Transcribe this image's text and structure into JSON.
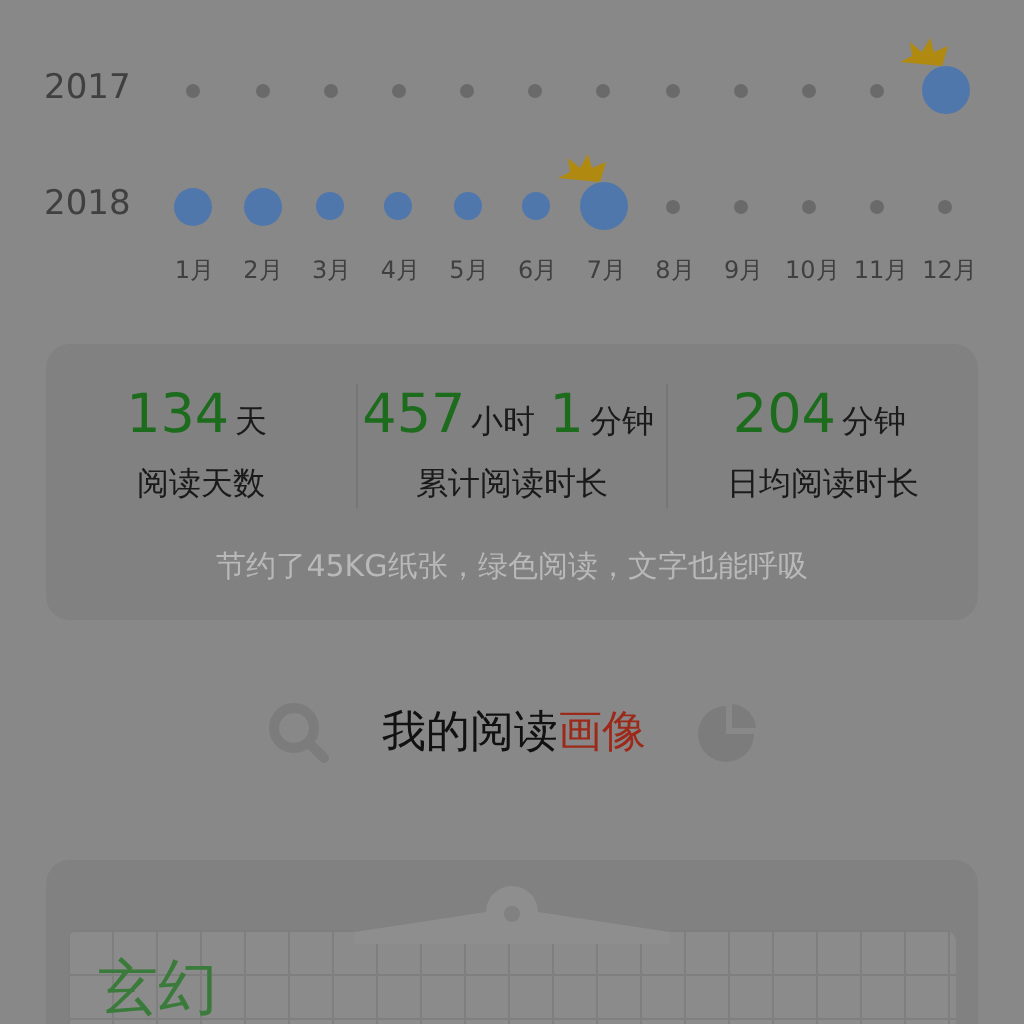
{
  "calendar": {
    "years": [
      {
        "label": "2017",
        "months": [
          {
            "kind": "empty"
          },
          {
            "kind": "empty"
          },
          {
            "kind": "empty"
          },
          {
            "kind": "empty"
          },
          {
            "kind": "empty"
          },
          {
            "kind": "empty"
          },
          {
            "kind": "empty"
          },
          {
            "kind": "empty"
          },
          {
            "kind": "empty"
          },
          {
            "kind": "empty"
          },
          {
            "kind": "empty"
          },
          {
            "kind": "large",
            "crowned": true
          }
        ]
      },
      {
        "label": "2018",
        "months": [
          {
            "kind": "medium",
            "crowned": false
          },
          {
            "kind": "medium",
            "crowned": false
          },
          {
            "kind": "small",
            "crowned": false
          },
          {
            "kind": "small",
            "crowned": false
          },
          {
            "kind": "small",
            "crowned": false
          },
          {
            "kind": "small",
            "crowned": false
          },
          {
            "kind": "large",
            "crowned": true
          },
          {
            "kind": "empty"
          },
          {
            "kind": "empty"
          },
          {
            "kind": "empty"
          },
          {
            "kind": "empty"
          },
          {
            "kind": "empty"
          }
        ]
      }
    ],
    "month_labels": [
      "1月",
      "2月",
      "3月",
      "4月",
      "5月",
      "6月",
      "7月",
      "8月",
      "9月",
      "10月",
      "11月",
      "12月"
    ]
  },
  "stats": {
    "items": [
      {
        "parts": [
          {
            "value": "134",
            "unit": "天"
          }
        ],
        "label": "阅读天数"
      },
      {
        "parts": [
          {
            "value": "457",
            "unit": "小时"
          },
          {
            "value": "1",
            "unit": "分钟"
          }
        ],
        "label": "累计阅读时长"
      },
      {
        "parts": [
          {
            "value": "204",
            "unit": "分钟"
          }
        ],
        "label": "日均阅读时长"
      }
    ],
    "note": "节约了45KG纸张，绿色阅读，文字也能呼吸"
  },
  "portrait": {
    "title_plain": "我的阅读",
    "title_highlight": "画像",
    "genre": "玄幻"
  }
}
